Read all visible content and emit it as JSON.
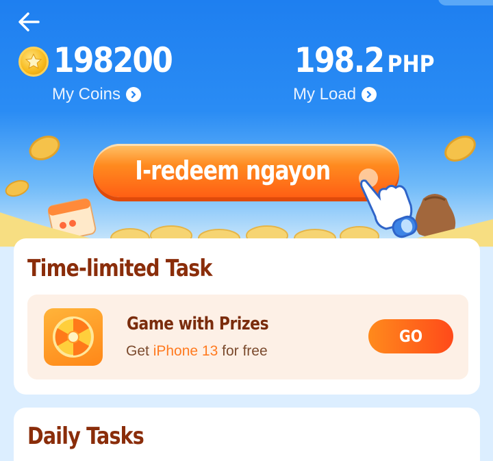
{
  "header": {
    "coins": {
      "value": "198200",
      "label": "My Coins"
    },
    "load": {
      "value": "198.2",
      "unit": "PHP",
      "label": "My Load"
    },
    "redeem_label": "I-redeem ngayon"
  },
  "time_limited": {
    "title": "Time-limited Task",
    "task": {
      "title": "Game with Prizes",
      "subtitle_prefix": "Get ",
      "subtitle_highlight": "iPhone 13",
      "subtitle_suffix": " for free",
      "button_label": "GO"
    }
  },
  "daily": {
    "title": "Daily Tasks"
  },
  "colors": {
    "primary_blue": "#1e7ff0",
    "accent_orange": "#ff6a14",
    "heading_brown": "#8a2d0a",
    "highlight_orange": "#ff7a1f"
  },
  "icons": [
    "back-arrow-icon",
    "coin-icon",
    "chevron-right-icon",
    "prize-wheel-icon",
    "pointing-hand-icon"
  ]
}
